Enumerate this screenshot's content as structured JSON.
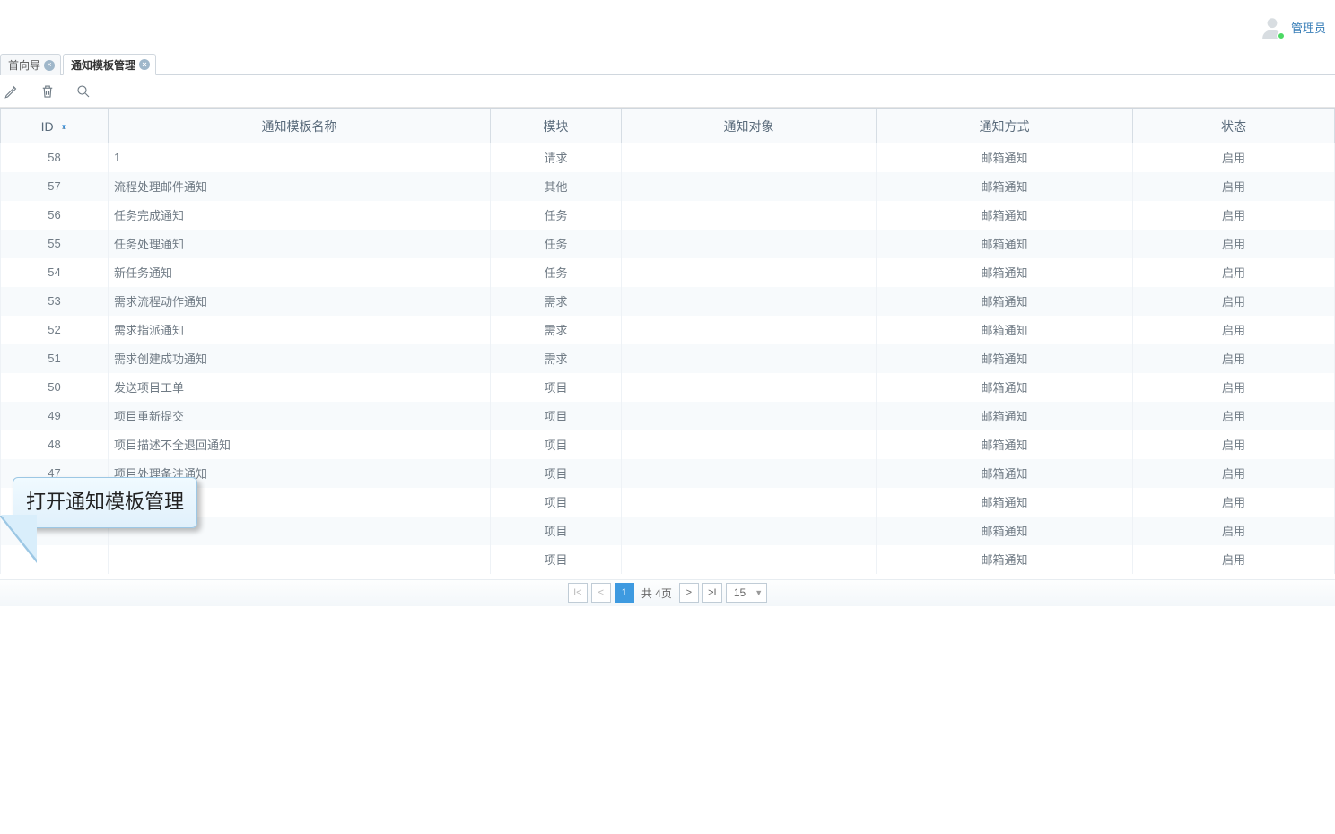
{
  "user": {
    "name": "管理员"
  },
  "tabs": [
    {
      "label": "首向导",
      "active": false
    },
    {
      "label": "通知模板管理",
      "active": true
    }
  ],
  "table": {
    "headers": {
      "id": "ID",
      "name": "通知模板名称",
      "module": "模块",
      "target": "通知对象",
      "method": "通知方式",
      "status": "状态"
    },
    "rows": [
      {
        "id": "58",
        "name": "1",
        "module": "请求",
        "target": "",
        "method": "邮箱通知",
        "status": "启用"
      },
      {
        "id": "57",
        "name": "流程处理邮件通知",
        "module": "其他",
        "target": "",
        "method": "邮箱通知",
        "status": "启用"
      },
      {
        "id": "56",
        "name": "任务完成通知",
        "module": "任务",
        "target": "",
        "method": "邮箱通知",
        "status": "启用"
      },
      {
        "id": "55",
        "name": "任务处理通知",
        "module": "任务",
        "target": "",
        "method": "邮箱通知",
        "status": "启用"
      },
      {
        "id": "54",
        "name": "新任务通知",
        "module": "任务",
        "target": "",
        "method": "邮箱通知",
        "status": "启用"
      },
      {
        "id": "53",
        "name": "需求流程动作通知",
        "module": "需求",
        "target": "",
        "method": "邮箱通知",
        "status": "启用"
      },
      {
        "id": "52",
        "name": "需求指派通知",
        "module": "需求",
        "target": "",
        "method": "邮箱通知",
        "status": "启用"
      },
      {
        "id": "51",
        "name": "需求创建成功通知",
        "module": "需求",
        "target": "",
        "method": "邮箱通知",
        "status": "启用"
      },
      {
        "id": "50",
        "name": "发送项目工单",
        "module": "项目",
        "target": "",
        "method": "邮箱通知",
        "status": "启用"
      },
      {
        "id": "49",
        "name": "项目重新提交",
        "module": "项目",
        "target": "",
        "method": "邮箱通知",
        "status": "启用"
      },
      {
        "id": "48",
        "name": "项目描述不全退回通知",
        "module": "项目",
        "target": "",
        "method": "邮箱通知",
        "status": "启用"
      },
      {
        "id": "47",
        "name": "项目处理备注通知",
        "module": "项目",
        "target": "",
        "method": "邮箱通知",
        "status": "启用"
      },
      {
        "id": "",
        "name": "",
        "module": "项目",
        "target": "",
        "method": "邮箱通知",
        "status": "启用"
      },
      {
        "id": "",
        "name": "",
        "module": "项目",
        "target": "",
        "method": "邮箱通知",
        "status": "启用"
      },
      {
        "id": "",
        "name": "",
        "module": "项目",
        "target": "",
        "method": "邮箱通知",
        "status": "启用"
      }
    ]
  },
  "pager": {
    "current": "1",
    "total_label": "共 4页",
    "page_size": "15"
  },
  "callout": {
    "text": "打开通知模板管理"
  }
}
